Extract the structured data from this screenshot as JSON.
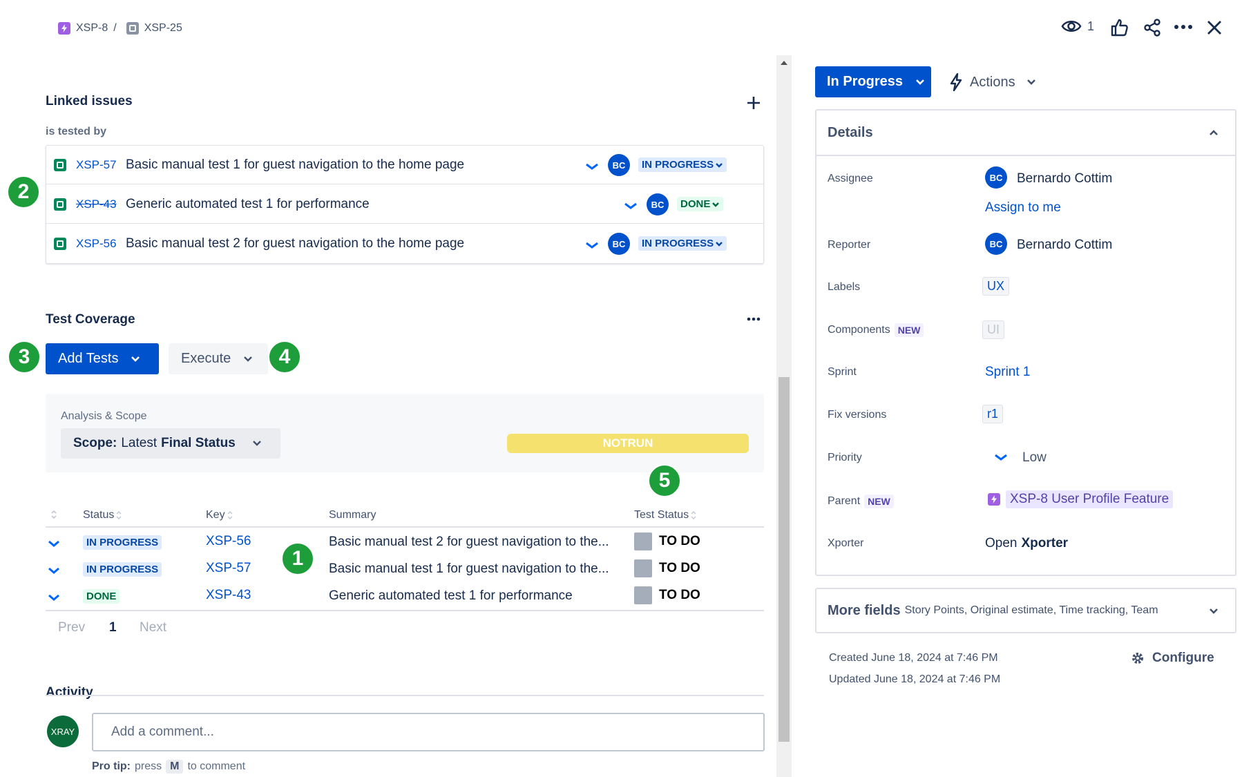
{
  "breadcrumb": {
    "parent_key": "XSP-8",
    "separator": "/",
    "current_key": "XSP-25"
  },
  "header_actions": {
    "watch_count": "1"
  },
  "linked_issues": {
    "title": "Linked issues",
    "relation": "is tested by",
    "items": [
      {
        "key": "XSP-57",
        "summary": "Basic manual test 1 for guest navigation to the home page",
        "avatar": "BC",
        "status": "IN PROGRESS",
        "struck": false
      },
      {
        "key": "XSP-43",
        "summary": "Generic automated test 1 for performance",
        "avatar": "BC",
        "status": "DONE",
        "struck": true
      },
      {
        "key": "XSP-56",
        "summary": "Basic manual test 2 for guest navigation to the home page",
        "avatar": "BC",
        "status": "IN PROGRESS",
        "struck": false
      }
    ]
  },
  "test_coverage": {
    "title": "Test Coverage",
    "add_tests_label": "Add Tests",
    "execute_label": "Execute",
    "analysis_label": "Analysis & Scope",
    "scope_prefix": "Scope:",
    "scope_mid": "Latest",
    "scope_bold": "Final Status",
    "bar_label": "NOTRUN",
    "bar_color": "#f4e16e",
    "columns": [
      "Status",
      "Key",
      "Summary",
      "Test Status"
    ],
    "rows": [
      {
        "status": "IN PROGRESS",
        "key": "XSP-56",
        "summary": "Basic manual test 2 for guest navigation to the...",
        "test_status": "TO DO"
      },
      {
        "status": "IN PROGRESS",
        "key": "XSP-57",
        "summary": "Basic manual test 1 for guest navigation to the...",
        "test_status": "TO DO"
      },
      {
        "status": "DONE",
        "key": "XSP-43",
        "summary": "Generic automated test 1 for performance",
        "test_status": "TO DO"
      }
    ],
    "pagination": {
      "prev": "Prev",
      "current": "1",
      "next": "Next"
    }
  },
  "activity": {
    "title": "Activity",
    "avatar": "XRAY",
    "comment_placeholder": "Add a comment...",
    "tip_bold": "Pro tip:",
    "tip_press": "press",
    "tip_key": "M",
    "tip_end": "to comment"
  },
  "callouts": [
    "1",
    "2",
    "3",
    "4",
    "5"
  ],
  "status_button": {
    "label": "In Progress",
    "color": "#0052cc"
  },
  "actions_label": "Actions",
  "details": {
    "title": "Details",
    "assignee_label": "Assignee",
    "assignee_avatar": "BC",
    "assignee_name": "Bernardo Cottim",
    "assign_to_me": "Assign to me",
    "reporter_label": "Reporter",
    "reporter_avatar": "BC",
    "reporter_name": "Bernardo Cottim",
    "labels_label": "Labels",
    "labels_value": "UX",
    "components_label": "Components",
    "components_badge": "NEW",
    "components_value": "UI",
    "sprint_label": "Sprint",
    "sprint_value": "Sprint 1",
    "fix_label": "Fix versions",
    "fix_value": "r1",
    "priority_label": "Priority",
    "priority_value": "Low",
    "parent_label": "Parent",
    "parent_badge": "NEW",
    "parent_value": "XSP-8 User Profile Feature",
    "xporter_label": "Xporter",
    "xporter_open": "Open",
    "xporter_bold": "Xporter"
  },
  "more_fields": {
    "title": "More fields",
    "hint": "Story Points, Original estimate, Time tracking, Team"
  },
  "footer": {
    "created": "Created June 18, 2024 at 7:46 PM",
    "updated": "Updated June 18, 2024 at 7:46 PM",
    "configure": "Configure"
  }
}
